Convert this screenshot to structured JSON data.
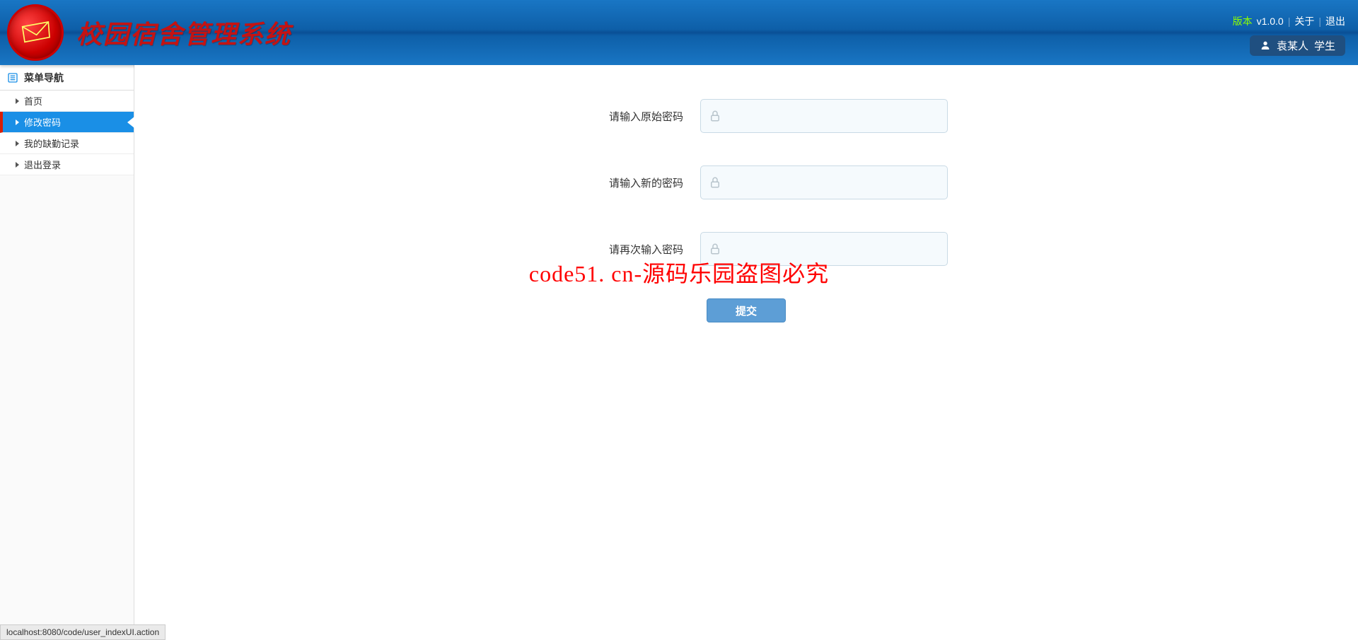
{
  "header": {
    "app_title": "校园宿舍管理系统",
    "version_label": "版本",
    "version_value": "v1.0.0",
    "about": "关于",
    "logout": "退出",
    "user_name": "袁某人",
    "user_role": "学生"
  },
  "sidebar": {
    "title": "菜单导航",
    "items": [
      {
        "label": "首页",
        "active": false
      },
      {
        "label": "修改密码",
        "active": true
      },
      {
        "label": "我的缺勤记录",
        "active": false
      },
      {
        "label": "退出登录",
        "active": false
      }
    ]
  },
  "form": {
    "old_pw_label": "请输入原始密码",
    "new_pw_label": "请输入新的密码",
    "confirm_pw_label": "请再次输入密码",
    "submit": "提交"
  },
  "watermark": "code51. cn-源码乐园盗图必究",
  "statusbar": "localhost:8080/code/user_indexUI.action"
}
